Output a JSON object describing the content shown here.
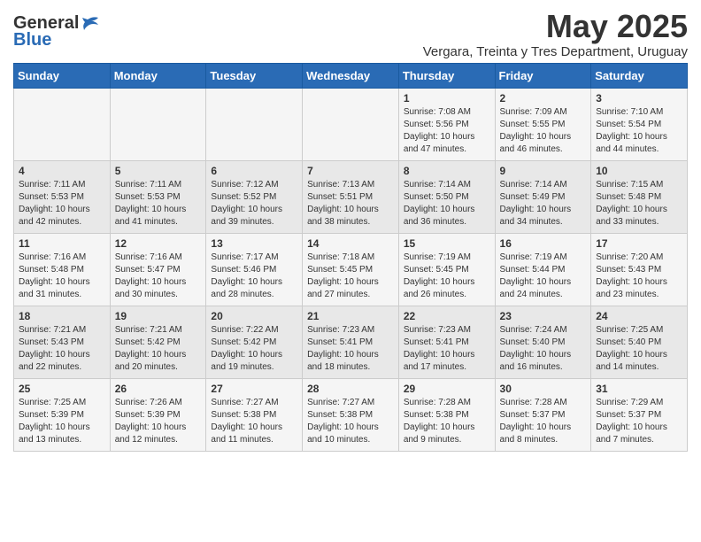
{
  "logo": {
    "general": "General",
    "blue": "Blue"
  },
  "title": "May 2025",
  "subtitle": "Vergara, Treinta y Tres Department, Uruguay",
  "days_of_week": [
    "Sunday",
    "Monday",
    "Tuesday",
    "Wednesday",
    "Thursday",
    "Friday",
    "Saturday"
  ],
  "weeks": [
    [
      {
        "day": "",
        "info": ""
      },
      {
        "day": "",
        "info": ""
      },
      {
        "day": "",
        "info": ""
      },
      {
        "day": "",
        "info": ""
      },
      {
        "day": "1",
        "info": "Sunrise: 7:08 AM\nSunset: 5:56 PM\nDaylight: 10 hours and 47 minutes."
      },
      {
        "day": "2",
        "info": "Sunrise: 7:09 AM\nSunset: 5:55 PM\nDaylight: 10 hours and 46 minutes."
      },
      {
        "day": "3",
        "info": "Sunrise: 7:10 AM\nSunset: 5:54 PM\nDaylight: 10 hours and 44 minutes."
      }
    ],
    [
      {
        "day": "4",
        "info": "Sunrise: 7:11 AM\nSunset: 5:53 PM\nDaylight: 10 hours and 42 minutes."
      },
      {
        "day": "5",
        "info": "Sunrise: 7:11 AM\nSunset: 5:53 PM\nDaylight: 10 hours and 41 minutes."
      },
      {
        "day": "6",
        "info": "Sunrise: 7:12 AM\nSunset: 5:52 PM\nDaylight: 10 hours and 39 minutes."
      },
      {
        "day": "7",
        "info": "Sunrise: 7:13 AM\nSunset: 5:51 PM\nDaylight: 10 hours and 38 minutes."
      },
      {
        "day": "8",
        "info": "Sunrise: 7:14 AM\nSunset: 5:50 PM\nDaylight: 10 hours and 36 minutes."
      },
      {
        "day": "9",
        "info": "Sunrise: 7:14 AM\nSunset: 5:49 PM\nDaylight: 10 hours and 34 minutes."
      },
      {
        "day": "10",
        "info": "Sunrise: 7:15 AM\nSunset: 5:48 PM\nDaylight: 10 hours and 33 minutes."
      }
    ],
    [
      {
        "day": "11",
        "info": "Sunrise: 7:16 AM\nSunset: 5:48 PM\nDaylight: 10 hours and 31 minutes."
      },
      {
        "day": "12",
        "info": "Sunrise: 7:16 AM\nSunset: 5:47 PM\nDaylight: 10 hours and 30 minutes."
      },
      {
        "day": "13",
        "info": "Sunrise: 7:17 AM\nSunset: 5:46 PM\nDaylight: 10 hours and 28 minutes."
      },
      {
        "day": "14",
        "info": "Sunrise: 7:18 AM\nSunset: 5:45 PM\nDaylight: 10 hours and 27 minutes."
      },
      {
        "day": "15",
        "info": "Sunrise: 7:19 AM\nSunset: 5:45 PM\nDaylight: 10 hours and 26 minutes."
      },
      {
        "day": "16",
        "info": "Sunrise: 7:19 AM\nSunset: 5:44 PM\nDaylight: 10 hours and 24 minutes."
      },
      {
        "day": "17",
        "info": "Sunrise: 7:20 AM\nSunset: 5:43 PM\nDaylight: 10 hours and 23 minutes."
      }
    ],
    [
      {
        "day": "18",
        "info": "Sunrise: 7:21 AM\nSunset: 5:43 PM\nDaylight: 10 hours and 22 minutes."
      },
      {
        "day": "19",
        "info": "Sunrise: 7:21 AM\nSunset: 5:42 PM\nDaylight: 10 hours and 20 minutes."
      },
      {
        "day": "20",
        "info": "Sunrise: 7:22 AM\nSunset: 5:42 PM\nDaylight: 10 hours and 19 minutes."
      },
      {
        "day": "21",
        "info": "Sunrise: 7:23 AM\nSunset: 5:41 PM\nDaylight: 10 hours and 18 minutes."
      },
      {
        "day": "22",
        "info": "Sunrise: 7:23 AM\nSunset: 5:41 PM\nDaylight: 10 hours and 17 minutes."
      },
      {
        "day": "23",
        "info": "Sunrise: 7:24 AM\nSunset: 5:40 PM\nDaylight: 10 hours and 16 minutes."
      },
      {
        "day": "24",
        "info": "Sunrise: 7:25 AM\nSunset: 5:40 PM\nDaylight: 10 hours and 14 minutes."
      }
    ],
    [
      {
        "day": "25",
        "info": "Sunrise: 7:25 AM\nSunset: 5:39 PM\nDaylight: 10 hours and 13 minutes."
      },
      {
        "day": "26",
        "info": "Sunrise: 7:26 AM\nSunset: 5:39 PM\nDaylight: 10 hours and 12 minutes."
      },
      {
        "day": "27",
        "info": "Sunrise: 7:27 AM\nSunset: 5:38 PM\nDaylight: 10 hours and 11 minutes."
      },
      {
        "day": "28",
        "info": "Sunrise: 7:27 AM\nSunset: 5:38 PM\nDaylight: 10 hours and 10 minutes."
      },
      {
        "day": "29",
        "info": "Sunrise: 7:28 AM\nSunset: 5:38 PM\nDaylight: 10 hours and 9 minutes."
      },
      {
        "day": "30",
        "info": "Sunrise: 7:28 AM\nSunset: 5:37 PM\nDaylight: 10 hours and 8 minutes."
      },
      {
        "day": "31",
        "info": "Sunrise: 7:29 AM\nSunset: 5:37 PM\nDaylight: 10 hours and 7 minutes."
      }
    ]
  ]
}
